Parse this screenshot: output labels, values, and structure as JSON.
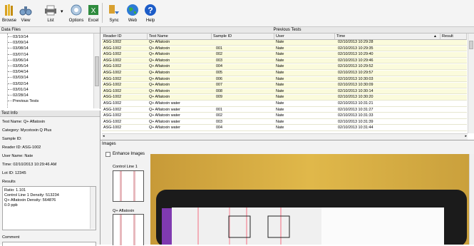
{
  "toolbar": {
    "buttons": [
      {
        "label": "Browse"
      },
      {
        "label": "View"
      },
      {
        "label": "List"
      },
      {
        "label": "Options"
      },
      {
        "label": "Excel"
      },
      {
        "label": "Sync"
      },
      {
        "label": "Web"
      },
      {
        "label": "Help"
      }
    ]
  },
  "data_files": {
    "title": "Data Files",
    "items": [
      "03/10/14",
      "03/09/14",
      "03/08/14",
      "03/07/14",
      "03/06/14",
      "03/05/14",
      "03/04/14",
      "03/03/14",
      "03/02/14",
      "03/01/14",
      "02/28/14",
      "Previous Tests"
    ]
  },
  "test_info": {
    "title": "Test Info",
    "test_name": "Test Name: Q+ Aflatoxin",
    "category": "Category: Mycotoxin Q Plus",
    "sample_id": "Sample ID:",
    "reader_id": "Reader ID: ASG-1002",
    "user_name": "User Name: Nate",
    "time": "Time: 02/10/2013  10:29:46 AM",
    "lot_id": "Lot ID: 12345",
    "results_label": "Results",
    "results_text": [
      "Ratio: 1.101",
      "Control Line 1 Density: 513234",
      "Q+ Aflatoxin Density: 564876",
      "0.0 ppb"
    ],
    "comment_label": "Comment"
  },
  "grid": {
    "title": "Previous Tests",
    "columns": [
      "Reader ID",
      "Test Name",
      "Sample ID",
      "User",
      "Time",
      "Result"
    ],
    "rows": [
      [
        "ASG-1002",
        "Q+ Aflatoxin",
        "",
        "Nate",
        "02/10/2013 10:29:28"
      ],
      [
        "ASG-1002",
        "Q+ Aflatoxin",
        "001",
        "Nate",
        "02/10/2013 10:29:35"
      ],
      [
        "ASG-1002",
        "Q+ Aflatoxin",
        "002",
        "Nate",
        "02/10/2013 10:29:40"
      ],
      [
        "ASG-1002",
        "Q+ Aflatoxin",
        "003",
        "Nate",
        "02/10/2013 10:29:46"
      ],
      [
        "ASG-1002",
        "Q+ Aflatoxin",
        "004",
        "Nate",
        "02/10/2013 10:29:52"
      ],
      [
        "ASG-1002",
        "Q+ Aflatoxin",
        "005",
        "Nate",
        "02/10/2013 10:29:57"
      ],
      [
        "ASG-1002",
        "Q+ Aflatoxin",
        "006",
        "Nate",
        "02/10/2013 10:30:03"
      ],
      [
        "ASG-1002",
        "Q+ Aflatoxin",
        "007",
        "Nate",
        "02/10/2013 10:30:09"
      ],
      [
        "ASG-1002",
        "Q+ Aflatoxin",
        "008",
        "Nate",
        "02/10/2013 10:30:14"
      ],
      [
        "ASG-1002",
        "Q+ Aflatoxin",
        "009",
        "Nate",
        "02/10/2013 10:30:20"
      ],
      [
        "ASG-1002",
        "Q+ Aflatoxin water",
        "",
        "Nate",
        "02/10/2013 10:31:21"
      ],
      [
        "ASG-1002",
        "Q+ Aflatoxin water",
        "001",
        "Nate",
        "02/10/2013 10:31:27"
      ],
      [
        "ASG-1002",
        "Q+ Aflatoxin water",
        "002",
        "Nate",
        "02/10/2013 10:31:33"
      ],
      [
        "ASG-1002",
        "Q+ Aflatoxin water",
        "003",
        "Nate",
        "02/10/2013 10:31:39"
      ],
      [
        "ASG-1002",
        "Q+ Aflatoxin water",
        "004",
        "Nate",
        "02/10/2013 10:31:44"
      ]
    ]
  },
  "images": {
    "title": "Images",
    "enhance_label": "Enhance Images",
    "thumbs": [
      {
        "label": "Control Line 1"
      },
      {
        "label": "Q+ Aflatoxin"
      }
    ]
  }
}
